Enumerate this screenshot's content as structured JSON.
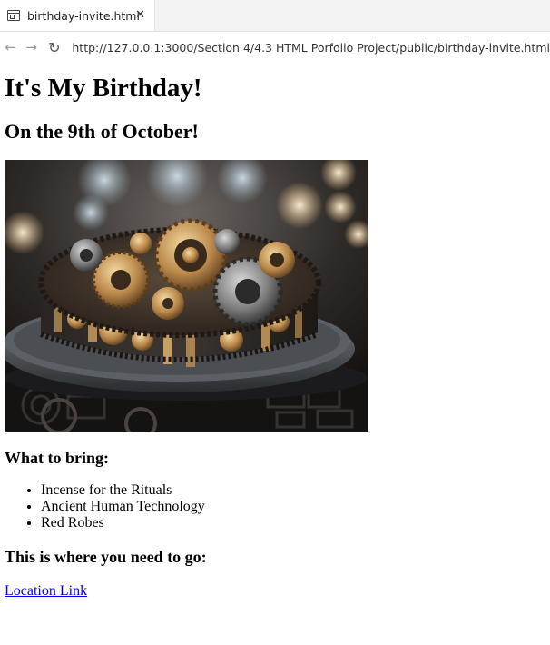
{
  "browser": {
    "tab_title": "birthday-invite.html",
    "tab_close": "✕",
    "url": "http://127.0.0.1:3000/Section 4/4.3 HTML Porfolio Project/public/birthday-invite.html"
  },
  "page": {
    "heading": "It's My Birthday!",
    "subheading": "On the 9th of October!",
    "bring_heading": "What to bring:",
    "bring_items": [
      "Incense for the Rituals",
      "Ancient Human Technology",
      "Red Robes"
    ],
    "location_heading": "This is where you need to go:",
    "location_link": "Location Link"
  },
  "icons": {
    "back": "back-arrow-icon",
    "forward": "forward-arrow-icon",
    "reload": "reload-icon",
    "tab": "page-icon",
    "close": "close-icon"
  }
}
